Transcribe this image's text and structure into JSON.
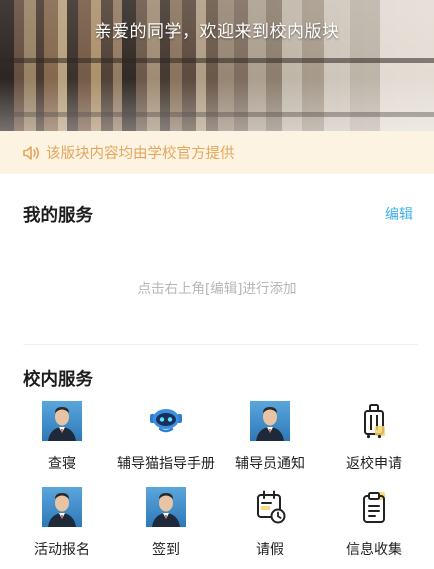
{
  "banner": {
    "title": "亲爱的同学，欢迎来到校内版块"
  },
  "notice": {
    "text": "该版块内容均由学校官方提供",
    "icon": "speaker-icon",
    "color": "#e4a65a"
  },
  "my_services": {
    "title": "我的服务",
    "edit_label": "编辑",
    "empty_hint": "点击右上角[编辑]进行添加"
  },
  "campus_services": {
    "title": "校内服务",
    "items": [
      {
        "label": "查寝",
        "icon": "portrait-icon"
      },
      {
        "label": "辅导猫指导手册",
        "icon": "mascot-robot-icon"
      },
      {
        "label": "辅导员通知",
        "icon": "portrait-icon"
      },
      {
        "label": "返校申请",
        "icon": "luggage-icon"
      },
      {
        "label": "活动报名",
        "icon": "portrait-icon"
      },
      {
        "label": "签到",
        "icon": "portrait-icon"
      },
      {
        "label": "请假",
        "icon": "calendar-clock-icon"
      },
      {
        "label": "信息收集",
        "icon": "clipboard-icon"
      }
    ]
  },
  "colors": {
    "accent": "#3fb0e6",
    "notice_bg": "#fdf3e3",
    "notice_text": "#e4a65a"
  }
}
